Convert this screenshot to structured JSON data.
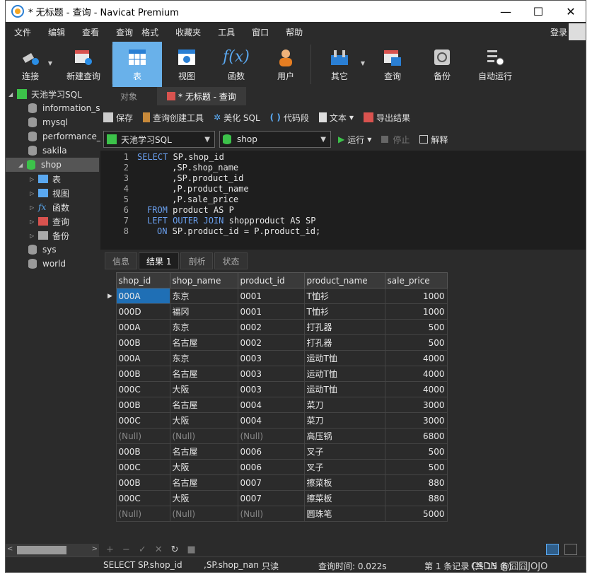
{
  "window": {
    "title": "* 无标题 - 查询 - Navicat Premium",
    "minimize": "—",
    "maximize": "☐",
    "close": "✕"
  },
  "menu": {
    "items": [
      "文件",
      "编辑",
      "查看",
      "查询",
      "格式",
      "收藏夹",
      "工具",
      "窗口",
      "帮助"
    ],
    "login": "登录"
  },
  "toolbar": {
    "items": [
      {
        "label": "连接"
      },
      {
        "label": "新建查询"
      },
      {
        "label": "表"
      },
      {
        "label": "视图"
      },
      {
        "label": "函数"
      },
      {
        "label": "用户"
      },
      {
        "label": "其它"
      },
      {
        "label": "查询"
      },
      {
        "label": "备份"
      },
      {
        "label": "自动运行"
      }
    ]
  },
  "sidebar": {
    "connection": "天池学习SQL",
    "databases": [
      "information_s",
      "mysql",
      "performance_",
      "sakila",
      "shop",
      "sys",
      "world"
    ],
    "shop_children": [
      "表",
      "视图",
      "函数",
      "查询",
      "备份"
    ]
  },
  "tabs": {
    "objects": "对象",
    "query": "* 无标题 - 查询"
  },
  "query_toolbar": {
    "save": "保存",
    "builder": "查询创建工具",
    "beautify": "美化 SQL",
    "snippet": "代码段",
    "text": "文本",
    "export": "导出结果"
  },
  "connbar": {
    "connection": "天池学习SQL",
    "database": "shop",
    "run": "运行",
    "stop": "停止",
    "explain": "解释"
  },
  "editor": {
    "lines": [
      [
        "SELECT",
        " SP.shop_id"
      ],
      [
        "",
        " ,SP.shop_name"
      ],
      [
        "",
        " ,SP.product_id"
      ],
      [
        "",
        " ,P.product_name"
      ],
      [
        "",
        " ,P.sale_price"
      ],
      [
        "FROM",
        " product AS P"
      ],
      [
        "LEFT OUTER JOIN",
        " shopproduct AS SP"
      ],
      [
        "ON",
        " SP.product_id = P.product_id;"
      ]
    ]
  },
  "result_tabs": [
    "信息",
    "结果 1",
    "剖析",
    "状态"
  ],
  "table": {
    "columns": [
      "shop_id",
      "shop_name",
      "product_id",
      "product_name",
      "sale_price"
    ],
    "rows": [
      [
        "000A",
        "东京",
        "0001",
        "T恤衫",
        "1000"
      ],
      [
        "000D",
        "福冈",
        "0001",
        "T恤衫",
        "1000"
      ],
      [
        "000A",
        "东京",
        "0002",
        "打孔器",
        "500"
      ],
      [
        "000B",
        "名古屋",
        "0002",
        "打孔器",
        "500"
      ],
      [
        "000A",
        "东京",
        "0003",
        "运动T恤",
        "4000"
      ],
      [
        "000B",
        "名古屋",
        "0003",
        "运动T恤",
        "4000"
      ],
      [
        "000C",
        "大阪",
        "0003",
        "运动T恤",
        "4000"
      ],
      [
        "000B",
        "名古屋",
        "0004",
        "菜刀",
        "3000"
      ],
      [
        "000C",
        "大阪",
        "0004",
        "菜刀",
        "3000"
      ],
      [
        "(Null)",
        "(Null)",
        "(Null)",
        "高压锅",
        "6800"
      ],
      [
        "000B",
        "名古屋",
        "0006",
        "叉子",
        "500"
      ],
      [
        "000C",
        "大阪",
        "0006",
        "叉子",
        "500"
      ],
      [
        "000B",
        "名古屋",
        "0007",
        "擦菜板",
        "880"
      ],
      [
        "000C",
        "大阪",
        "0007",
        "擦菜板",
        "880"
      ],
      [
        "(Null)",
        "(Null)",
        "(Null)",
        "圆珠笔",
        "5000"
      ]
    ]
  },
  "status": {
    "sql": "SELECT SP.shop_id",
    "sql2": ",SP.shop_nan",
    "readonly": "只读",
    "time": "查询时间: 0.022s",
    "records": "第 1 条记录 (共 15 条)",
    "watermark": "CSDN @囧囧JOJO"
  }
}
